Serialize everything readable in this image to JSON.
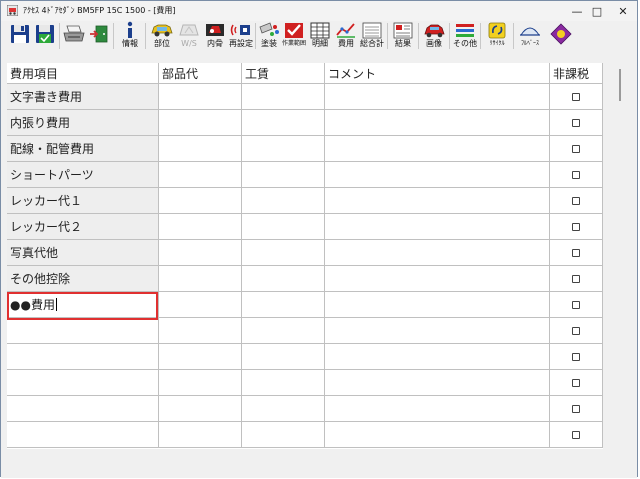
{
  "window": {
    "title": "ｱｸｾｽ 4ﾄﾞｱｾﾀﾞﾝ BM5FP 15C 1500 - [費用]",
    "minimize_glyph": "—",
    "maximize_glyph": "□",
    "close_glyph": "✕"
  },
  "toolbar": {
    "buttons": [
      {
        "name": "save",
        "label": "",
        "icon": "floppy-disk-icon"
      },
      {
        "name": "save-as",
        "label": "",
        "icon": "floppy-disk-green-icon"
      },
      {
        "name": "print",
        "label": "",
        "icon": "printer-icon"
      },
      {
        "name": "exit",
        "label": "",
        "icon": "door-exit-icon"
      },
      {
        "name": "info",
        "label": "情報",
        "icon": "info-icon"
      },
      {
        "name": "parts",
        "label": "部位",
        "icon": "car-parts-icon"
      },
      {
        "name": "ws",
        "label": "W/S",
        "icon": "windshield-icon",
        "disabled": true
      },
      {
        "name": "interior",
        "label": "内骨",
        "icon": "interior-icon"
      },
      {
        "name": "resetting",
        "label": "再設定",
        "icon": "reset-icon"
      },
      {
        "name": "paint",
        "label": "塗装",
        "icon": "paint-icon"
      },
      {
        "name": "work",
        "label": "作業範囲",
        "icon": "checklist-icon"
      },
      {
        "name": "detail",
        "label": "明細",
        "icon": "grid-detail-icon"
      },
      {
        "name": "cost",
        "label": "費用",
        "icon": "cost-graph-icon",
        "active": true
      },
      {
        "name": "total",
        "label": "総合計",
        "icon": "total-sheet-icon"
      },
      {
        "name": "result",
        "label": "結果",
        "icon": "result-sheet-icon"
      },
      {
        "name": "image",
        "label": "画像",
        "icon": "car-image-icon"
      },
      {
        "name": "other",
        "label": "その他",
        "icon": "other-tools-icon"
      },
      {
        "name": "recycle",
        "label": "ﾘｻｲｸﾙ",
        "icon": "recycle-icon"
      },
      {
        "name": "fullbase",
        "label": "ﾌﾙﾍﾞｰｽ",
        "icon": "dome-icon"
      },
      {
        "name": "extra",
        "label": "",
        "icon": "diamond-badge-icon"
      }
    ]
  },
  "table": {
    "headers": [
      "費用項目",
      "部品代",
      "工賃",
      "コメント",
      "非課税"
    ],
    "rows": [
      {
        "item": "文字書き費用"
      },
      {
        "item": "内張り費用"
      },
      {
        "item": "配線・配管費用"
      },
      {
        "item": "ショートパーツ"
      },
      {
        "item": "レッカー代１"
      },
      {
        "item": "レッカー代２"
      },
      {
        "item": "写真代他"
      },
      {
        "item": "その他控除"
      },
      {
        "item": "●●費用",
        "editing": true
      },
      {
        "item": ""
      },
      {
        "item": ""
      },
      {
        "item": ""
      },
      {
        "item": ""
      },
      {
        "item": ""
      }
    ],
    "tax_exempt_checked": false
  },
  "colors": {
    "selection_border": "#e03030",
    "active_tab_underline": "#2a5bd7",
    "grid_line": "#c0c0c0",
    "item_column_bg": "#eeeeee"
  }
}
